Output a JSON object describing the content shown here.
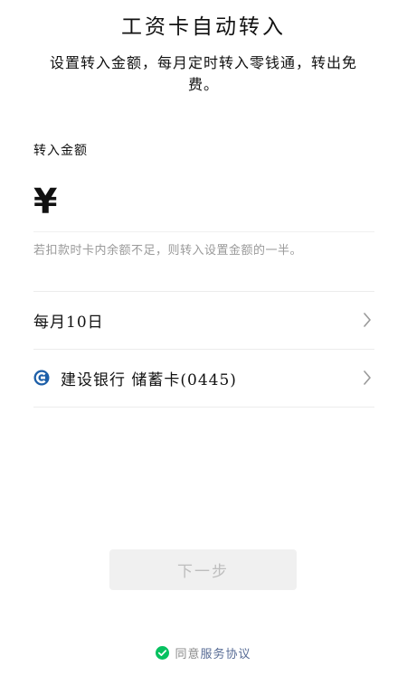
{
  "header": {
    "title": "工资卡自动转入",
    "subtitle": "设置转入金额，每月定时转入零钱通，转出免费。"
  },
  "amount": {
    "label": "转入金额",
    "currency_symbol": "¥",
    "value": "",
    "placeholder": "",
    "hint": "若扣款时卡内余额不足，则转入设置金额的一半。"
  },
  "schedule": {
    "label": "每月10日",
    "icon": "chevron-right-icon"
  },
  "bank_card": {
    "label": "建设银行 储蓄卡(0445)",
    "logo_icon": "ccb-bank-logo-icon",
    "brand_color": "#1d5fa8",
    "icon": "chevron-right-icon"
  },
  "actions": {
    "next_label": "下一步"
  },
  "agreement": {
    "prefix": "同意",
    "link_text": "服务协议",
    "checked": true,
    "check_color": "#07c160"
  }
}
